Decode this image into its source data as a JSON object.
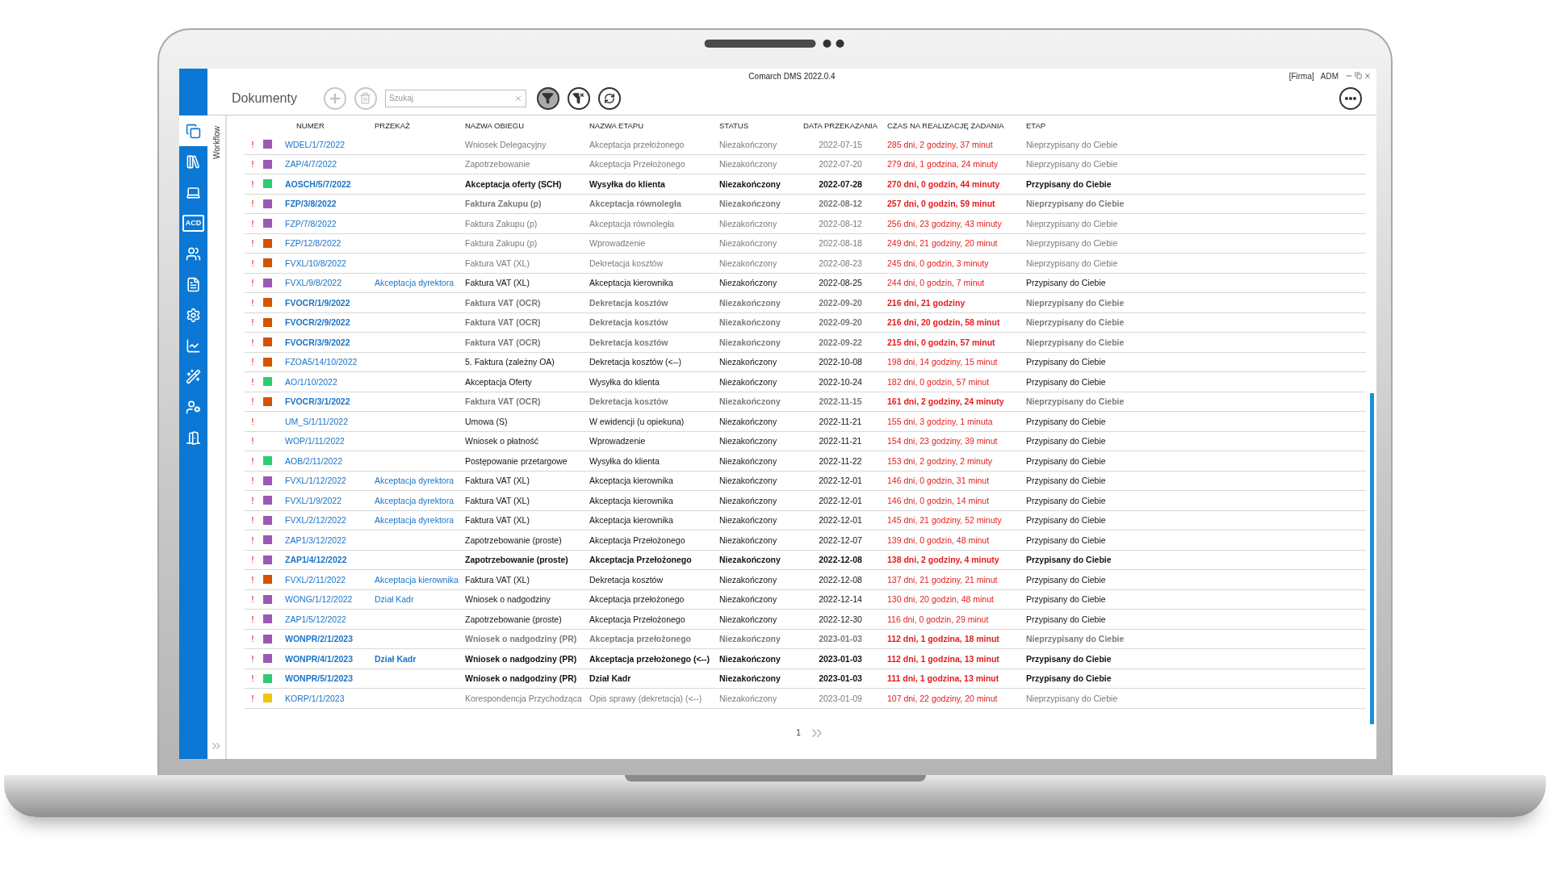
{
  "window": {
    "title": "Comarch DMS 2022.0.4",
    "company": "[Firma]",
    "user": "ADM"
  },
  "sidebar": {
    "items": [
      {
        "kind": "documents",
        "selected": true
      },
      {
        "kind": "binders",
        "selected": false
      },
      {
        "kind": "laptop",
        "selected": false
      },
      {
        "kind": "acd",
        "label": "ACD",
        "selected": false
      },
      {
        "kind": "users",
        "selected": false
      },
      {
        "kind": "document",
        "selected": false
      },
      {
        "kind": "settings",
        "selected": false
      },
      {
        "kind": "chart",
        "selected": false
      },
      {
        "kind": "wand",
        "selected": false
      },
      {
        "kind": "user-settings",
        "selected": false
      },
      {
        "kind": "exit",
        "selected": false
      }
    ]
  },
  "side_tab": "Workflow",
  "toolbar": {
    "title": "Dokumenty",
    "search": {
      "placeholder": "Szukaj"
    },
    "filter_on": true
  },
  "table": {
    "columns": [
      "NUMER",
      "PRZEKAŻ",
      "NAZWA OBIEGU",
      "NAZWA ETAPU",
      "STATUS",
      "DATA PRZEKAZANIA",
      "CZAS NA REALIZACJĘ ZADANIA",
      "ETAP"
    ],
    "rows": [
      {
        "priority": "!",
        "color": "#9b59b6",
        "number": "WDEL/1/7/2022",
        "handover": "",
        "workflow": "Wniosek Delegacyjny",
        "step": "Akceptacja przełożonego",
        "status": "Niezakończony",
        "date": "2022-07-15",
        "time": "285 dni, 2 godziny, 37 minut",
        "stage": "Nieprzypisany do Ciebie",
        "bold": false,
        "assigned": false
      },
      {
        "priority": "!",
        "color": "#9b59b6",
        "number": "ZAP/4/7/2022",
        "handover": "",
        "workflow": "Zapotrzebowanie",
        "step": "Akceptacja Przełożonego",
        "status": "Niezakończony",
        "date": "2022-07-20",
        "time": "279 dni, 1 godzina, 24 minuty",
        "stage": "Nieprzypisany do Ciebie",
        "bold": false,
        "assigned": false
      },
      {
        "priority": "!",
        "color": "#2ecc71",
        "number": "AOSCH/5/7/2022",
        "handover": "",
        "workflow": "Akceptacja oferty (SCH)",
        "step": "Wysyłka do klienta",
        "status": "Niezakończony",
        "date": "2022-07-28",
        "time": "270 dni, 0 godzin, 44 minuty",
        "stage": "Przypisany do Ciebie",
        "bold": true,
        "assigned": true
      },
      {
        "priority": "!",
        "color": "#9b59b6",
        "number": "FZP/3/8/2022",
        "handover": "",
        "workflow": "Faktura Zakupu (p)",
        "step": "Akceptacja równoległa",
        "status": "Niezakończony",
        "date": "2022-08-12",
        "time": "257 dni, 0 godzin, 59 minut",
        "stage": "Nieprzypisany do Ciebie",
        "bold": true,
        "assigned": false
      },
      {
        "priority": "!",
        "color": "#9b59b6",
        "number": "FZP/7/8/2022",
        "handover": "",
        "workflow": "Faktura Zakupu (p)",
        "step": "Akceptacja równoległa",
        "status": "Niezakończony",
        "date": "2022-08-12",
        "time": "256 dni, 23 godziny, 43 minuty",
        "stage": "Nieprzypisany do Ciebie",
        "bold": false,
        "assigned": false
      },
      {
        "priority": "!",
        "color": "#d35400",
        "number": "FZP/12/8/2022",
        "handover": "",
        "workflow": "Faktura Zakupu (p)",
        "step": "Wprowadzenie",
        "status": "Niezakończony",
        "date": "2022-08-18",
        "time": "249 dni, 21 godziny, 20 minut",
        "stage": "Nieprzypisany do Ciebie",
        "bold": false,
        "assigned": false
      },
      {
        "priority": "!",
        "color": "#d35400",
        "number": "FVXL/10/8/2022",
        "handover": "",
        "workflow": "Faktura VAT (XL)",
        "step": "Dekretacja kosztów",
        "status": "Niezakończony",
        "date": "2022-08-23",
        "time": "245 dni, 0 godzin, 3 minuty",
        "stage": "Nieprzypisany do Ciebie",
        "bold": false,
        "assigned": false
      },
      {
        "priority": "!",
        "color": "#9b59b6",
        "number": "FVXL/9/8/2022",
        "handover": "Akceptacja dyrektora",
        "workflow": "Faktura VAT (XL)",
        "step": "Akceptacja kierownika",
        "status": "Niezakończony",
        "date": "2022-08-25",
        "time": "244 dni, 0 godzin, 7 minut",
        "stage": "Przypisany do Ciebie",
        "bold": false,
        "assigned": true
      },
      {
        "priority": "!",
        "color": "#d35400",
        "number": "FVOCR/1/9/2022",
        "handover": "",
        "workflow": "Faktura VAT (OCR)",
        "step": "Dekretacja kosztów",
        "status": "Niezakończony",
        "date": "2022-09-20",
        "time": "216 dni, 21 godziny",
        "stage": "Nieprzypisany do Ciebie",
        "bold": true,
        "assigned": false
      },
      {
        "priority": "!",
        "color": "#d35400",
        "number": "FVOCR/2/9/2022",
        "handover": "",
        "workflow": "Faktura VAT (OCR)",
        "step": "Dekretacja kosztów",
        "status": "Niezakończony",
        "date": "2022-09-20",
        "time": "216 dni, 20 godzin, 58 minut",
        "stage": "Nieprzypisany do Ciebie",
        "bold": true,
        "assigned": false
      },
      {
        "priority": "!",
        "color": "#d35400",
        "number": "FVOCR/3/9/2022",
        "handover": "",
        "workflow": "Faktura VAT (OCR)",
        "step": "Dekretacja kosztów",
        "status": "Niezakończony",
        "date": "2022-09-22",
        "time": "215 dni, 0 godzin, 57 minut",
        "stage": "Nieprzypisany do Ciebie",
        "bold": true,
        "assigned": false
      },
      {
        "priority": "!",
        "color": "#d35400",
        "number": "FZOA5/14/10/2022",
        "handover": "",
        "workflow": "5. Faktura (zależny OA)",
        "step": "Dekretacja kosztów (<--)",
        "status": "Niezakończony",
        "date": "2022-10-08",
        "time": "198 dni, 14 godziny, 15 minut",
        "stage": "Przypisany do Ciebie",
        "bold": false,
        "assigned": true
      },
      {
        "priority": "!",
        "color": "#2ecc71",
        "number": "AO/1/10/2022",
        "handover": "",
        "workflow": "Akceptacja Oferty",
        "step": "Wysyłka do klienta",
        "status": "Niezakończony",
        "date": "2022-10-24",
        "time": "182 dni, 0 godzin, 57 minut",
        "stage": "Przypisany do Ciebie",
        "bold": false,
        "assigned": true
      },
      {
        "priority": "!",
        "color": "#d35400",
        "number": "FVOCR/3/1/2022",
        "handover": "",
        "workflow": "Faktura VAT (OCR)",
        "step": "Dekretacja kosztów",
        "status": "Niezakończony",
        "date": "2022-11-15",
        "time": "161 dni, 2 godziny, 24 minuty",
        "stage": "Nieprzypisany do Ciebie",
        "bold": true,
        "assigned": false
      },
      {
        "priority": "!",
        "number": "UM_S/1/11/2022",
        "handover": "",
        "workflow": "Umowa (S)",
        "step": "W ewidencji (u opiekuna)",
        "status": "Niezakończony",
        "date": "2022-11-21",
        "time": "155 dni, 3 godziny, 1 minuta",
        "stage": "Przypisany do Ciebie",
        "bold": false,
        "assigned": true
      },
      {
        "priority": "!",
        "number": "WOP/1/11/2022",
        "handover": "",
        "workflow": "Wniosek o płatność",
        "step": "Wprowadzenie",
        "status": "Niezakończony",
        "date": "2022-11-21",
        "time": "154 dni, 23 godziny, 39 minut",
        "stage": "Przypisany do Ciebie",
        "bold": false,
        "assigned": true
      },
      {
        "priority": "!",
        "color": "#2ecc71",
        "number": "AOB/2/11/2022",
        "handover": "",
        "workflow": "Postępowanie przetargowe",
        "step": "Wysyłka do klienta",
        "status": "Niezakończony",
        "date": "2022-11-22",
        "time": "153 dni, 2 godziny, 2 minuty",
        "stage": "Przypisany do Ciebie",
        "bold": false,
        "assigned": true
      },
      {
        "priority": "!",
        "color": "#9b59b6",
        "number": "FVXL/1/12/2022",
        "handover": "Akceptacja dyrektora",
        "workflow": "Faktura VAT (XL)",
        "step": "Akceptacja kierownika",
        "status": "Niezakończony",
        "date": "2022-12-01",
        "time": "146 dni, 0 godzin, 31 minut",
        "stage": "Przypisany do Ciebie",
        "bold": false,
        "assigned": true
      },
      {
        "priority": "!",
        "color": "#9b59b6",
        "number": "FVXL/1/9/2022",
        "handover": "Akceptacja dyrektora",
        "workflow": "Faktura VAT (XL)",
        "step": "Akceptacja kierownika",
        "status": "Niezakończony",
        "date": "2022-12-01",
        "time": "146 dni, 0 godzin, 14 minut",
        "stage": "Przypisany do Ciebie",
        "bold": false,
        "assigned": true
      },
      {
        "priority": "!",
        "color": "#9b59b6",
        "number": "FVXL/2/12/2022",
        "handover": "Akceptacja dyrektora",
        "workflow": "Faktura VAT (XL)",
        "step": "Akceptacja kierownika",
        "status": "Niezakończony",
        "date": "2022-12-01",
        "time": "145 dni, 21 godziny, 52 minuty",
        "stage": "Przypisany do Ciebie",
        "bold": false,
        "assigned": true
      },
      {
        "priority": "!",
        "color": "#9b59b6",
        "number": "ZAP1/3/12/2022",
        "handover": "",
        "workflow": "Zapotrzebowanie (proste)",
        "step": "Akceptacja Przełożonego",
        "status": "Niezakończony",
        "date": "2022-12-07",
        "time": "139 dni, 0 godzin, 48 minut",
        "stage": "Przypisany do Ciebie",
        "bold": false,
        "assigned": true
      },
      {
        "priority": "!",
        "color": "#9b59b6",
        "number": "ZAP1/4/12/2022",
        "handover": "",
        "workflow": "Zapotrzebowanie (proste)",
        "step": "Akceptacja Przełożonego",
        "status": "Niezakończony",
        "date": "2022-12-08",
        "time": "138 dni, 2 godziny, 4 minuty",
        "stage": "Przypisany do Ciebie",
        "bold": true,
        "assigned": true
      },
      {
        "priority": "!",
        "color": "#d35400",
        "number": "FVXL/2/11/2022",
        "handover": "Akceptacja kierownika",
        "workflow": "Faktura VAT (XL)",
        "step": "Dekretacja kosztów",
        "status": "Niezakończony",
        "date": "2022-12-08",
        "time": "137 dni, 21 godziny, 21 minut",
        "stage": "Przypisany do Ciebie",
        "bold": false,
        "assigned": true
      },
      {
        "priority": "!",
        "color": "#9b59b6",
        "number": "WONG/1/12/2022",
        "handover": "Dział Kadr",
        "workflow": "Wniosek o nadgodziny",
        "step": "Akceptacja przełożonego",
        "status": "Niezakończony",
        "date": "2022-12-14",
        "time": "130 dni, 20 godzin, 48 minut",
        "stage": "Przypisany do Ciebie",
        "bold": false,
        "assigned": true
      },
      {
        "priority": "!",
        "color": "#9b59b6",
        "number": "ZAP1/5/12/2022",
        "handover": "",
        "workflow": "Zapotrzebowanie (proste)",
        "step": "Akceptacja Przełożonego",
        "status": "Niezakończony",
        "date": "2022-12-30",
        "time": "116 dni, 0 godzin, 29 minut",
        "stage": "Przypisany do Ciebie",
        "bold": false,
        "assigned": true
      },
      {
        "priority": "!",
        "color": "#9b59b6",
        "number": "WONPR/2/1/2023",
        "handover": "",
        "workflow": "Wniosek o nadgodziny (PR)",
        "step": "Akceptacja przełożonego",
        "status": "Niezakończony",
        "date": "2023-01-03",
        "time": "112 dni, 1 godzina, 18 minut",
        "stage": "Nieprzypisany do Ciebie",
        "bold": true,
        "assigned": false
      },
      {
        "priority": "!",
        "color": "#9b59b6",
        "number": "WONPR/4/1/2023",
        "handover": "Dział Kadr",
        "workflow": "Wniosek o nadgodziny (PR)",
        "step": "Akceptacja przełożonego (<--)",
        "status": "Niezakończony",
        "date": "2023-01-03",
        "time": "112 dni, 1 godzina, 13 minut",
        "stage": "Przypisany do Ciebie",
        "bold": true,
        "assigned": true
      },
      {
        "priority": "!",
        "color": "#2ecc71",
        "number": "WONPR/5/1/2023",
        "handover": "",
        "workflow": "Wniosek o nadgodziny (PR)",
        "step": "Dział Kadr",
        "status": "Niezakończony",
        "date": "2023-01-03",
        "time": "111 dni, 1 godzina, 13 minut",
        "stage": "Przypisany do Ciebie",
        "bold": true,
        "assigned": true
      },
      {
        "priority": "!",
        "color": "#f1c40f",
        "number": "KORP/1/1/2023",
        "handover": "",
        "workflow": "Korespondencja Przychodząca",
        "step": "Opis sprawy (dekretacja) (<--)",
        "status": "Niezakończony",
        "date": "2023-01-09",
        "time": "107 dni, 22 godziny, 20 minut",
        "stage": "Nieprzypisany do Ciebie",
        "bold": false,
        "assigned": false
      }
    ]
  },
  "pagination": {
    "page": "1"
  }
}
